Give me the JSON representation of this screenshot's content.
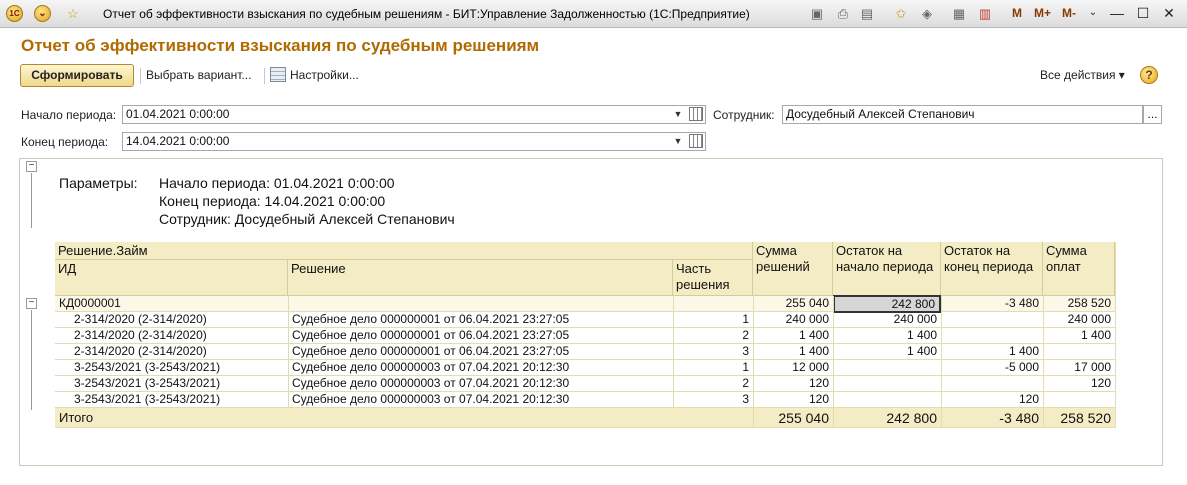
{
  "window": {
    "logo": "1С",
    "title": "Отчет об эффективности взыскания по судебным решениям - БИТ:Управление Задолженностью  (1С:Предприятие)",
    "mbuttons": [
      "M",
      "M+",
      "M-"
    ]
  },
  "report": {
    "heading": "Отчет об эффективности взыскания по судебным решениям"
  },
  "toolbar": {
    "generate": "Сформировать",
    "choose_variant": "Выбрать вариант...",
    "settings": "Настройки...",
    "all_actions": "Все действия ▾",
    "help": "?"
  },
  "fields": {
    "start_label": "Начало периода:",
    "start_value": "01.04.2021  0:00:00",
    "end_label": "Конец периода:",
    "end_value": "14.04.2021  0:00:00",
    "employee_label": "Сотрудник:",
    "employee_value": "Досудебный Алексей Степанович",
    "employee_button": "..."
  },
  "params": {
    "label": "Параметры:",
    "line1": "Начало периода: 01.04.2021 0:00:00",
    "line2": "Конец периода: 14.04.2021 0:00:00",
    "line3": "Сотрудник: Досудебный Алексей Степанович"
  },
  "table": {
    "headers": {
      "decision_loan": "Решение.Займ",
      "id": "ИД",
      "decision": "Решение",
      "part": "Часть решения",
      "sum_decisions": "Сумма решений",
      "balance_start": "Остаток на начало периода",
      "balance_end": "Остаток на конец периода",
      "sum_payments": "Сумма оплат"
    },
    "group": {
      "name": "КД0000001",
      "sum_decisions": "255 040",
      "balance_start": "242 800",
      "balance_end": "-3 480",
      "sum_payments": "258 520"
    },
    "rows": [
      {
        "id": "2-314/2020 (2-314/2020)",
        "decision": "Судебное дело 000000001 от 06.04.2021 23:27:05",
        "part": "1",
        "sum_decisions": "240 000",
        "balance_start": "240 000",
        "balance_end": "",
        "sum_payments": "240 000"
      },
      {
        "id": "2-314/2020 (2-314/2020)",
        "decision": "Судебное дело 000000001 от 06.04.2021 23:27:05",
        "part": "2",
        "sum_decisions": "1 400",
        "balance_start": "1 400",
        "balance_end": "",
        "sum_payments": "1 400"
      },
      {
        "id": "2-314/2020 (2-314/2020)",
        "decision": "Судебное дело 000000001 от 06.04.2021 23:27:05",
        "part": "3",
        "sum_decisions": "1 400",
        "balance_start": "1 400",
        "balance_end": "1 400",
        "sum_payments": ""
      },
      {
        "id": "3-2543/2021 (3-2543/2021)",
        "decision": "Судебное дело 000000003 от 07.04.2021 20:12:30",
        "part": "1",
        "sum_decisions": "12 000",
        "balance_start": "",
        "balance_end": "-5 000",
        "sum_payments": "17 000"
      },
      {
        "id": "3-2543/2021 (3-2543/2021)",
        "decision": "Судебное дело 000000003 от 07.04.2021 20:12:30",
        "part": "2",
        "sum_decisions": "120",
        "balance_start": "",
        "balance_end": "",
        "sum_payments": "120"
      },
      {
        "id": "3-2543/2021 (3-2543/2021)",
        "decision": "Судебное дело 000000003 от 07.04.2021 20:12:30",
        "part": "3",
        "sum_decisions": "120",
        "balance_start": "",
        "balance_end": "120",
        "sum_payments": ""
      }
    ],
    "total": {
      "label": "Итого",
      "sum_decisions": "255 040",
      "balance_start": "242 800",
      "balance_end": "-3 480",
      "sum_payments": "258 520"
    }
  }
}
